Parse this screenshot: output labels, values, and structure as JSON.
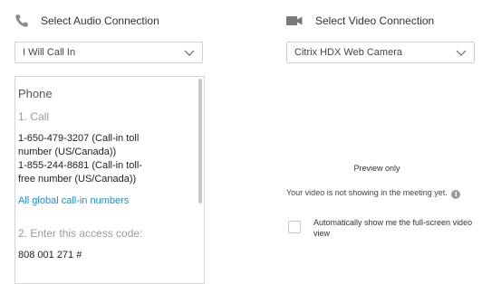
{
  "audio": {
    "header_label": "Select Audio Connection",
    "header_icon": "phone-handset-icon",
    "select_value": "I Will Call In",
    "phone_panel": {
      "title": "Phone",
      "step1": "1. Call",
      "numbers": [
        "1-650-479-3207 (Call-in toll",
        "number (US/Canada))",
        "1-855-244-8681 (Call-in toll-",
        "free number (US/Canada))"
      ],
      "global_link": "All global call-in numbers",
      "step2": "2. Enter this access code:",
      "access_code": "808 001 271 #"
    }
  },
  "video": {
    "header_label": "Select Video Connection",
    "header_icon": "video-camera-icon",
    "select_value": "Citrix HDX Web Camera",
    "preview_label": "Preview only",
    "status_message": "Your video is not showing in the meeting yet.",
    "auto_fullscreen_label": "Automatically show me the full-screen video view"
  },
  "colors": {
    "link": "#1a8fd6",
    "icon_gray": "#8c8c8c",
    "border": "#cfcfcf"
  }
}
